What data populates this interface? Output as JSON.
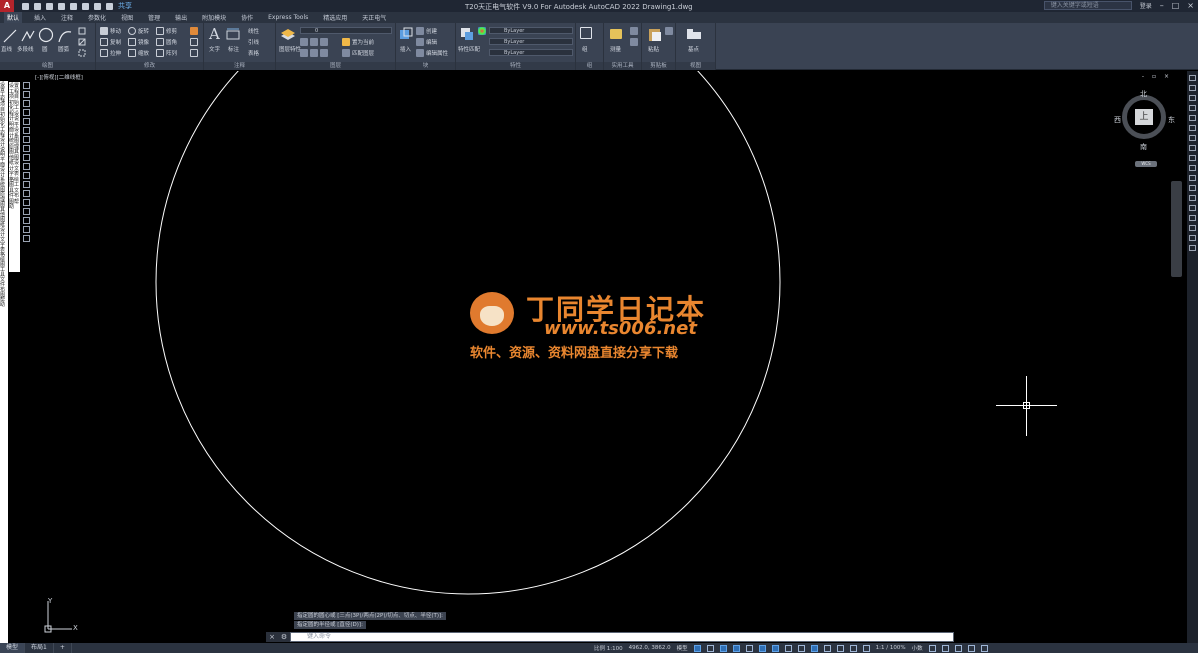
{
  "app": {
    "logo": "A",
    "title": "T20天正电气软件 V9.0 For Autodesk AutoCAD 2022    Drawing1.dwg",
    "share_label": "共享",
    "search_placeholder": "键入关键字或短语",
    "login_label": "登录"
  },
  "tabs": [
    "默认",
    "插入",
    "注释",
    "参数化",
    "视图",
    "管理",
    "输出",
    "附加模块",
    "协作",
    "Express Tools",
    "精选应用",
    "天正电气"
  ],
  "ribbon": {
    "draw": {
      "label": "绘图",
      "line": "直线",
      "polyline": "多段线",
      "circle": "圆",
      "arc": "圆弧"
    },
    "modify": {
      "label": "修改",
      "move": "移动",
      "rotate": "旋转",
      "trim": "修剪",
      "copy": "复制",
      "mirror": "镜像",
      "fillet": "圆角",
      "stretch": "拉伸",
      "scale": "缩放",
      "array": "阵列"
    },
    "annotation": {
      "label": "注释",
      "text": "文字",
      "dimension": "标注",
      "linear": "线性",
      "leader": "引线",
      "table": "表格"
    },
    "layers": {
      "label": "图层",
      "properties": "图层特性",
      "current": "0",
      "make_current": "置为当前",
      "match": "匹配图层"
    },
    "block": {
      "label": "块",
      "insert": "插入",
      "create": "创建",
      "edit": "编辑",
      "edit_attr": "编辑属性"
    },
    "properties": {
      "label": "特性",
      "match": "特性匹配",
      "color": "ByLayer",
      "linetype": "ByLayer",
      "lineweight": "ByLayer"
    },
    "groups": {
      "label": "组",
      "group": "组"
    },
    "utilities": {
      "label": "实用工具",
      "measure": "测量"
    },
    "clipboard": {
      "label": "剪贴板",
      "paste": "粘贴"
    },
    "view": {
      "label": "视图",
      "base": "基点"
    }
  },
  "viewport": {
    "label": "[-][俯视][二维线框]",
    "controls": "- ▫ ×"
  },
  "side_panel": {
    "text": "设置工程项目初始化工程设计说明平面设计系统图原理图其他图纸设计文字表格绘图工具文件布图帮助"
  },
  "viewcube": {
    "north": "北",
    "south": "南",
    "east": "东",
    "west": "西",
    "face": "上",
    "wcs": "WCS"
  },
  "watermark": {
    "title": "丁同学日记本",
    "url": "www.ts006.net",
    "subtitle": "软件、资源、资料网盘直接分享下载"
  },
  "command": {
    "history": [
      "指定圆的圆心或 [三点(3P)/两点(2P)/切点、切点、半径(T)]:",
      "指定圆的半径或 [直径(D)]:"
    ],
    "placeholder": "键入命令"
  },
  "ucs": {
    "x": "X",
    "y": "Y"
  },
  "status": {
    "tabs": [
      "模型",
      "布局1",
      "+"
    ],
    "scale": "比例 1:100",
    "coords": "4962.0, 3862.0",
    "mode": "模型",
    "zoom": "1:1 / 100%",
    "decimal": "小数"
  },
  "colors": {
    "background": "#000000",
    "ribbon": "#3a4353",
    "accent": "#2f6fb5",
    "watermark": "#e9862f",
    "logo": "#b3242b"
  }
}
